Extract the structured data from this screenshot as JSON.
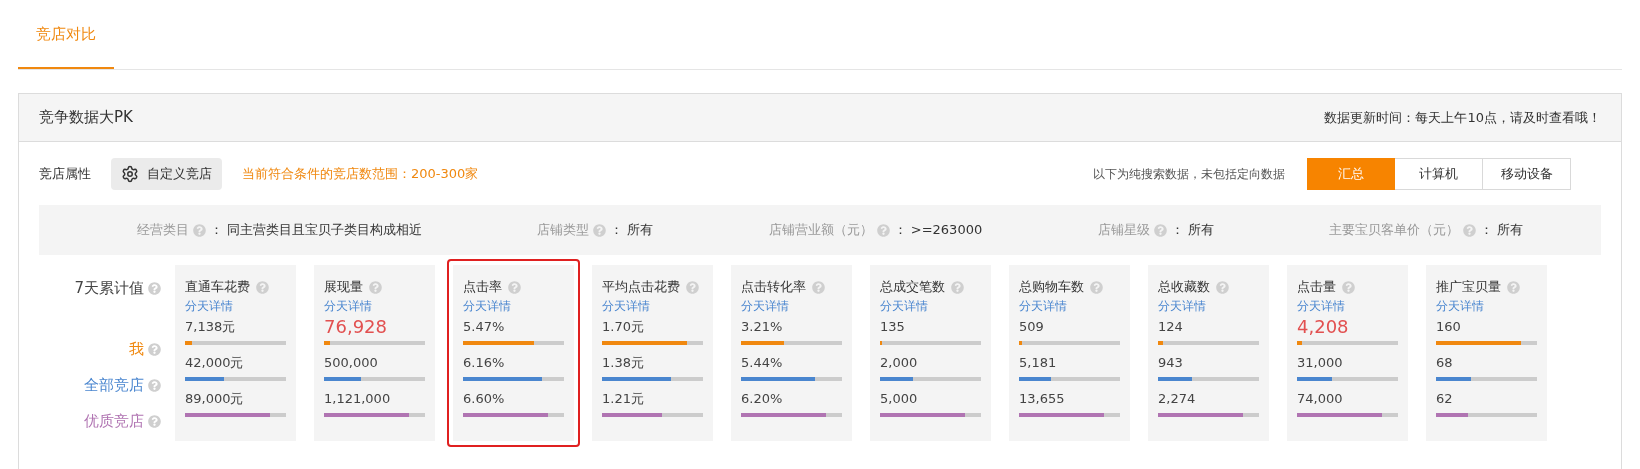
{
  "page_tabs": [
    {
      "label": "竞店对比",
      "selected": true
    }
  ],
  "panel": {
    "title": "竞争数据大PK",
    "update_note": "数据更新时间：每天上午10点，请及时查看哦！"
  },
  "filter": {
    "label": "竞店属性",
    "button": "自定义竞店",
    "range_note": "当前符合条件的竞店数范围：200-300家",
    "search_note": "以下为纯搜索数据，未包括定向数据"
  },
  "device_tabs": [
    {
      "label": "汇总",
      "selected": true
    },
    {
      "label": "计算机",
      "selected": false
    },
    {
      "label": "移动设备",
      "selected": false
    }
  ],
  "criteria": [
    {
      "label": "经营类目",
      "separator": "：",
      "value": "同主营类目且宝贝子类目构成相近"
    },
    {
      "label": "店铺类型",
      "separator": "：",
      "value": "所有"
    },
    {
      "label": "店铺营业额（元）",
      "separator": "：",
      "value": ">=263000"
    },
    {
      "label": "店铺星级",
      "separator": "：",
      "value": "所有"
    },
    {
      "label": "主要宝贝客单价（元）",
      "separator": "：",
      "value": "所有"
    }
  ],
  "period_label": "7天累计值",
  "rows": [
    {
      "label": "我",
      "color": "#f0880f"
    },
    {
      "label": "全部竞店",
      "color": "#4a86cf"
    },
    {
      "label": "优质竞店",
      "color": "#b074b2"
    }
  ],
  "metrics": [
    {
      "title": "直通车花费",
      "link": "分天详情",
      "highlighted": false,
      "values": [
        {
          "value": "7,138元",
          "level": 0.07,
          "emphasized": false
        },
        {
          "value": "42,000元",
          "level": 0.39,
          "emphasized": false
        },
        {
          "value": "89,000元",
          "level": 0.84,
          "emphasized": false
        }
      ]
    },
    {
      "title": "展现量",
      "link": "分天详情",
      "highlighted": false,
      "values": [
        {
          "value": "76,928",
          "level": 0.06,
          "emphasized": true
        },
        {
          "value": "500,000",
          "level": 0.37,
          "emphasized": false
        },
        {
          "value": "1,121,000",
          "level": 0.84,
          "emphasized": false
        }
      ]
    },
    {
      "title": "点击率",
      "link": "分天详情",
      "highlighted": true,
      "values": [
        {
          "value": "5.47%",
          "level": 0.7,
          "emphasized": false
        },
        {
          "value": "6.16%",
          "level": 0.78,
          "emphasized": false
        },
        {
          "value": "6.60%",
          "level": 0.84,
          "emphasized": false
        }
      ]
    },
    {
      "title": "平均点击花费",
      "link": "分天详情",
      "highlighted": false,
      "values": [
        {
          "value": "1.70元",
          "level": 0.84,
          "emphasized": false
        },
        {
          "value": "1.38元",
          "level": 0.68,
          "emphasized": false
        },
        {
          "value": "1.21元",
          "level": 0.59,
          "emphasized": false
        }
      ]
    },
    {
      "title": "点击转化率",
      "link": "分天详情",
      "highlighted": false,
      "values": [
        {
          "value": "3.21%",
          "level": 0.43,
          "emphasized": false
        },
        {
          "value": "5.44%",
          "level": 0.73,
          "emphasized": false
        },
        {
          "value": "6.20%",
          "level": 0.84,
          "emphasized": false
        }
      ]
    },
    {
      "title": "总成交笔数",
      "link": "分天详情",
      "highlighted": false,
      "values": [
        {
          "value": "135",
          "level": 0.02,
          "emphasized": false
        },
        {
          "value": "2,000",
          "level": 0.33,
          "emphasized": false
        },
        {
          "value": "5,000",
          "level": 0.84,
          "emphasized": false
        }
      ]
    },
    {
      "title": "总购物车数",
      "link": "分天详情",
      "highlighted": false,
      "values": [
        {
          "value": "509",
          "level": 0.03,
          "emphasized": false
        },
        {
          "value": "5,181",
          "level": 0.32,
          "emphasized": false
        },
        {
          "value": "13,655",
          "level": 0.84,
          "emphasized": false
        }
      ]
    },
    {
      "title": "总收藏数",
      "link": "分天详情",
      "highlighted": false,
      "values": [
        {
          "value": "124",
          "level": 0.05,
          "emphasized": false
        },
        {
          "value": "943",
          "level": 0.34,
          "emphasized": false
        },
        {
          "value": "2,274",
          "level": 0.84,
          "emphasized": false
        }
      ]
    },
    {
      "title": "点击量",
      "link": "分天详情",
      "highlighted": false,
      "values": [
        {
          "value": "4,208",
          "level": 0.05,
          "emphasized": true
        },
        {
          "value": "31,000",
          "level": 0.35,
          "emphasized": false
        },
        {
          "value": "74,000",
          "level": 0.84,
          "emphasized": false
        }
      ]
    },
    {
      "title": "推广宝贝量",
      "link": "分天详情",
      "highlighted": false,
      "values": [
        {
          "value": "160",
          "level": 0.84,
          "emphasized": false
        },
        {
          "value": "68",
          "level": 0.35,
          "emphasized": false
        },
        {
          "value": "62",
          "level": 0.32,
          "emphasized": false
        }
      ]
    }
  ]
}
